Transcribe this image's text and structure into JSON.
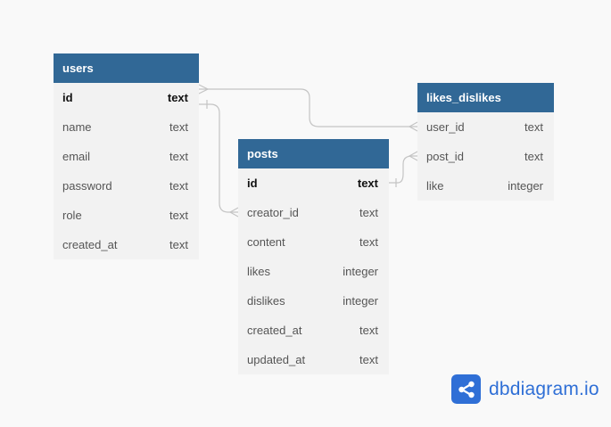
{
  "tables": {
    "users": {
      "name": "users",
      "fields": [
        {
          "name": "id",
          "type": "text",
          "pk": true
        },
        {
          "name": "name",
          "type": "text"
        },
        {
          "name": "email",
          "type": "text"
        },
        {
          "name": "password",
          "type": "text"
        },
        {
          "name": "role",
          "type": "text"
        },
        {
          "name": "created_at",
          "type": "text"
        }
      ]
    },
    "posts": {
      "name": "posts",
      "fields": [
        {
          "name": "id",
          "type": "text",
          "pk": true
        },
        {
          "name": "creator_id",
          "type": "text"
        },
        {
          "name": "content",
          "type": "text"
        },
        {
          "name": "likes",
          "type": "integer"
        },
        {
          "name": "dislikes",
          "type": "integer"
        },
        {
          "name": "created_at",
          "type": "text"
        },
        {
          "name": "updated_at",
          "type": "text"
        }
      ]
    },
    "likes_dislikes": {
      "name": "likes_dislikes",
      "fields": [
        {
          "name": "user_id",
          "type": "text"
        },
        {
          "name": "post_id",
          "type": "text"
        },
        {
          "name": "like",
          "type": "integer"
        }
      ]
    }
  },
  "relations": [
    {
      "from": "users.id",
      "to": "likes_dislikes.user_id"
    },
    {
      "from": "users.id",
      "to": "posts.creator_id"
    },
    {
      "from": "posts.id",
      "to": "likes_dislikes.post_id"
    }
  ],
  "brand": {
    "name": "dbdiagram.io",
    "icon": "share-nodes-icon",
    "color": "#2f6fd6"
  },
  "colors": {
    "header": "#316896",
    "table_body": "#f2f2f2",
    "connector": "#c4c4c4"
  }
}
